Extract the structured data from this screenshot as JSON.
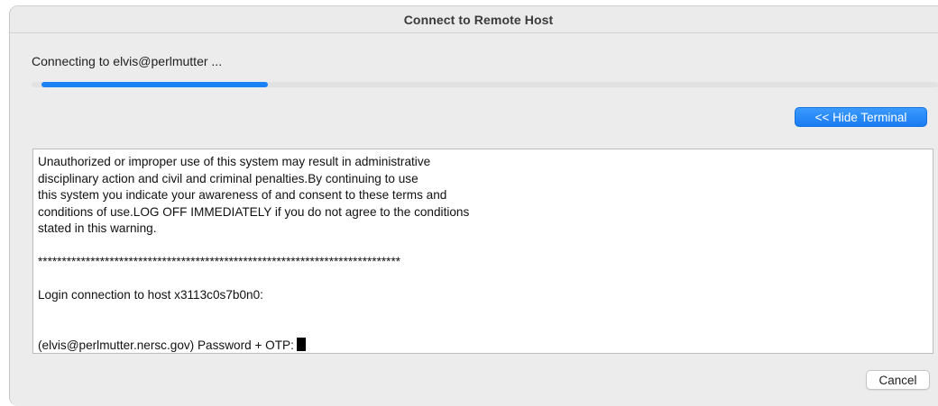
{
  "window": {
    "title": "Connect to Remote Host"
  },
  "status": {
    "text": "Connecting to elvis@perlmutter ...",
    "progress_fraction": 0.25
  },
  "buttons": {
    "hide_terminal_label": "<< Hide Terminal",
    "cancel_label": "Cancel"
  },
  "terminal": {
    "lines": [
      "Unauthorized or improper use of this system may result in administrative",
      "disciplinary action and civil and criminal penalties.By continuing to use",
      "this system you indicate your awareness of and consent to these terms and",
      "conditions of use.LOG OFF IMMEDIATELY if you do not agree to the conditions",
      "stated in this warning.",
      "",
      "****************************************************************************",
      "",
      "Login connection to host x3113c0s7b0n0:",
      "",
      "",
      "(elvis@perlmutter.nersc.gov) Password + OTP:"
    ]
  },
  "colors": {
    "accent": "#1a7bf2",
    "progress_fill": "#1a82f5",
    "window_bg": "#ececec"
  }
}
